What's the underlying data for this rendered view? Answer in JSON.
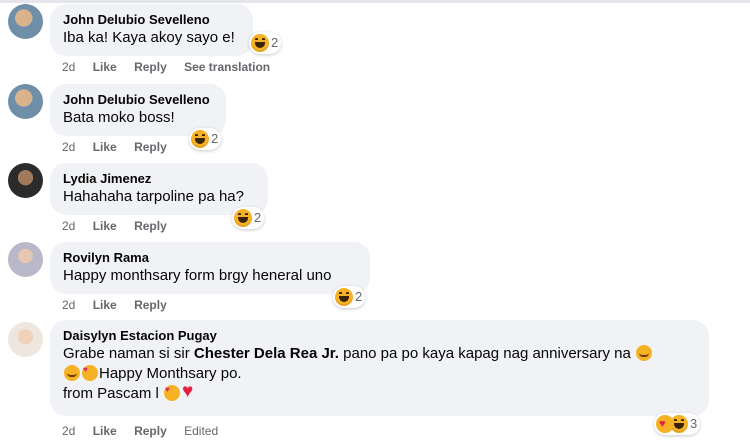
{
  "comments": [
    {
      "author": "John Delubio Sevelleno",
      "lines": [
        "Iba ka! Kaya akoy sayo e!"
      ],
      "reaction_count": "2",
      "time": "2d",
      "like": "Like",
      "reply": "Reply",
      "extra": "See translation"
    },
    {
      "author": "John Delubio Sevelleno",
      "lines": [
        "Bata moko boss!"
      ],
      "reaction_count": "2",
      "time": "2d",
      "like": "Like",
      "reply": "Reply"
    },
    {
      "author": "Lydia Jimenez",
      "lines": [
        "Hahahaha tarpoline pa ha?"
      ],
      "reaction_count": "2",
      "time": "2d",
      "like": "Like",
      "reply": "Reply"
    },
    {
      "author": "Rovilyn Rama",
      "lines": [
        "Happy monthsary form brgy heneral uno"
      ],
      "reaction_count": "2",
      "time": "2d",
      "like": "Like",
      "reply": "Reply"
    },
    {
      "author": "Daisylyn Estacion Pugay",
      "line1_before": "Grabe naman si sir ",
      "mention": "Chester Dela Rea Jr.",
      "line1_after": " pano pa po kaya kapag nag anniversary na",
      "line2": "Happy Monthsary po.",
      "line3": "from Pascam l",
      "reaction_count": "3",
      "time": "2d",
      "like": "Like",
      "reply": "Reply",
      "extra": "Edited"
    }
  ],
  "icons": {
    "reaction": "haha-reaction-icon",
    "reaction_care": "care-reaction-icon",
    "emoji_smile": "smiling-face-emoji",
    "emoji_love": "smiling-face-with-hearts-emoji",
    "emoji_heart": "heart-emoji"
  },
  "colors": {
    "bubble": "#f0f2f5",
    "meta_text": "#65676b",
    "reaction_yellow": "#f7b125"
  }
}
